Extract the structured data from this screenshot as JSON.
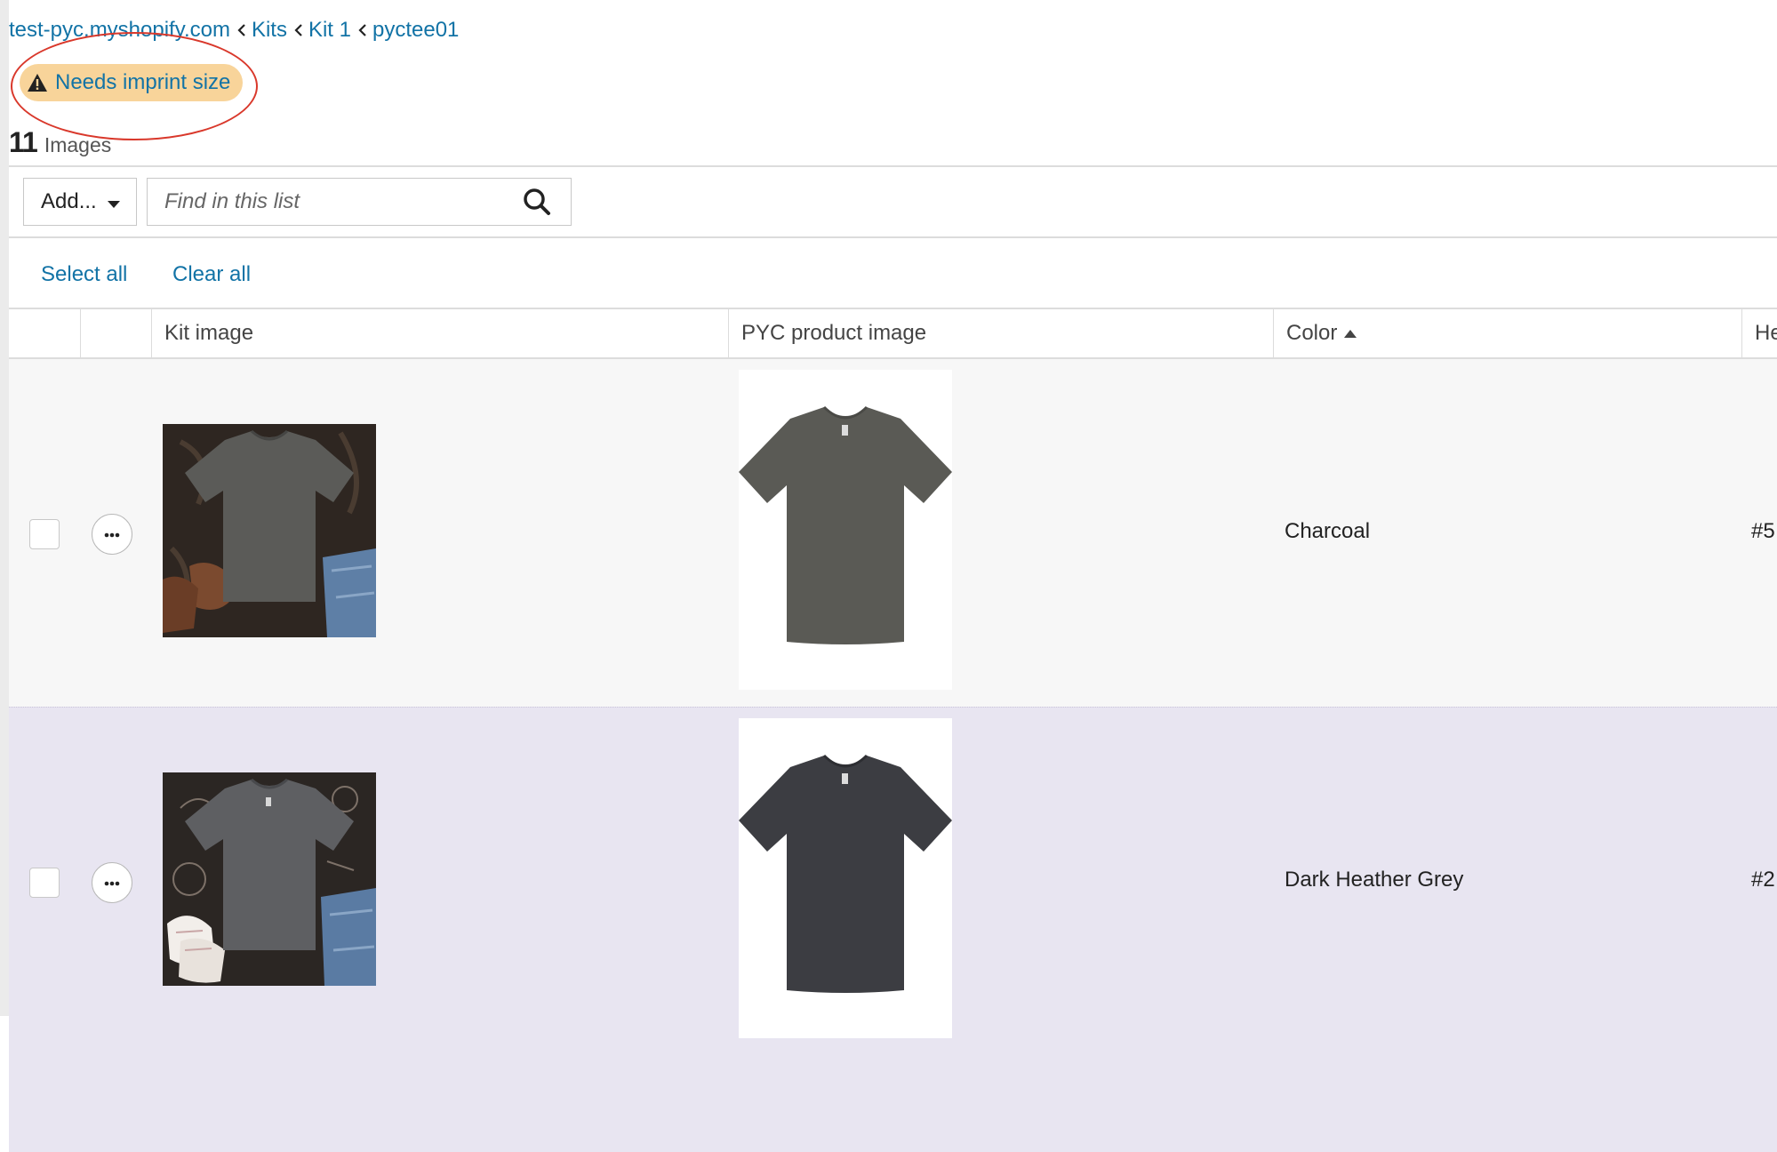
{
  "breadcrumb": {
    "items": [
      {
        "label": "test-pyc.myshopify.com"
      },
      {
        "label": "Kits"
      },
      {
        "label": "Kit 1"
      },
      {
        "label": "pyctee01"
      }
    ]
  },
  "warning": {
    "label": "Needs imprint size",
    "icon": "warning-triangle-icon"
  },
  "summary": {
    "count": "11",
    "label": "Images"
  },
  "toolbar": {
    "add_label": "Add...",
    "search_placeholder": "Find in this list",
    "select_all_label": "Select all",
    "clear_all_label": "Clear all"
  },
  "table": {
    "columns": [
      {
        "label": ""
      },
      {
        "label": ""
      },
      {
        "label": "Kit image"
      },
      {
        "label": "PYC product image"
      },
      {
        "label": "Color",
        "sort": "ascending"
      },
      {
        "label": "He"
      }
    ],
    "rows": [
      {
        "color": "Charcoal",
        "hex": "#5",
        "kit_image": "charcoal t-shirt flat lay with boots and jeans",
        "pyc_image": "charcoal t-shirt product photo",
        "shirt_color": "#5a5a55"
      },
      {
        "color": "Dark Heather Grey",
        "hex": "#2",
        "kit_image": "dark heather grey t-shirt flat lay with sneakers and jeans",
        "pyc_image": "dark heather grey t-shirt product photo",
        "shirt_color": "#3c3d42"
      }
    ]
  },
  "colors": {
    "link": "#1273a6",
    "warning_bg": "#f8d49a",
    "annotation": "#d9382b",
    "row_alt": "#e8e5f1"
  }
}
